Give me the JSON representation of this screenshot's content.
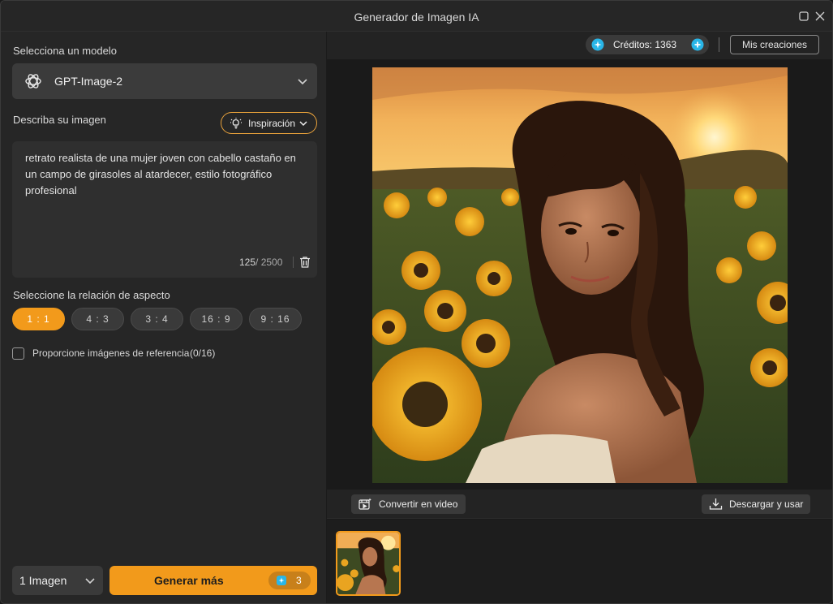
{
  "window": {
    "title": "Generador de Imagen IA"
  },
  "model": {
    "label": "Selecciona un modelo",
    "selected": "GPT-Image-2"
  },
  "prompt": {
    "label": "Describa su imagen",
    "inspiration_label": "Inspiración",
    "text": "retrato realista de una mujer joven con cabello castaño en un campo de girasoles al atardecer, estilo fotográfico profesional",
    "count": "125",
    "max": "/ 2500"
  },
  "aspect": {
    "label": "Seleccione la relación de aspecto",
    "options": [
      "1 : 1",
      "4 : 3",
      "3 : 4",
      "16 : 9",
      "9 : 16"
    ],
    "selected": "1 : 1"
  },
  "reference": {
    "label": "Proporcione imágenes de referencia",
    "count": "(0/16)",
    "checked": false
  },
  "generate": {
    "count_selected": "1 Imagen",
    "button_label": "Generar más",
    "cost": "3"
  },
  "topbar": {
    "credits_label": "Créditos: 1363",
    "my_creations": "Mis creaciones"
  },
  "actions": {
    "convert_video": "Convertir en video",
    "download_use": "Descargar y usar"
  },
  "colors": {
    "accent": "#f29a1b",
    "coin": "#29b6e8",
    "background": "#1f1f1f",
    "panel": "#262626"
  },
  "icons": {
    "model": "openai-logo-icon",
    "inspiration": "lightbulb-icon",
    "trash": "trash-icon",
    "coin": "credit-coin-icon",
    "add_credits": "plus-circle-icon",
    "convert": "video-sparkle-icon",
    "download": "download-icon",
    "maximize": "maximize-icon",
    "close": "close-icon"
  }
}
